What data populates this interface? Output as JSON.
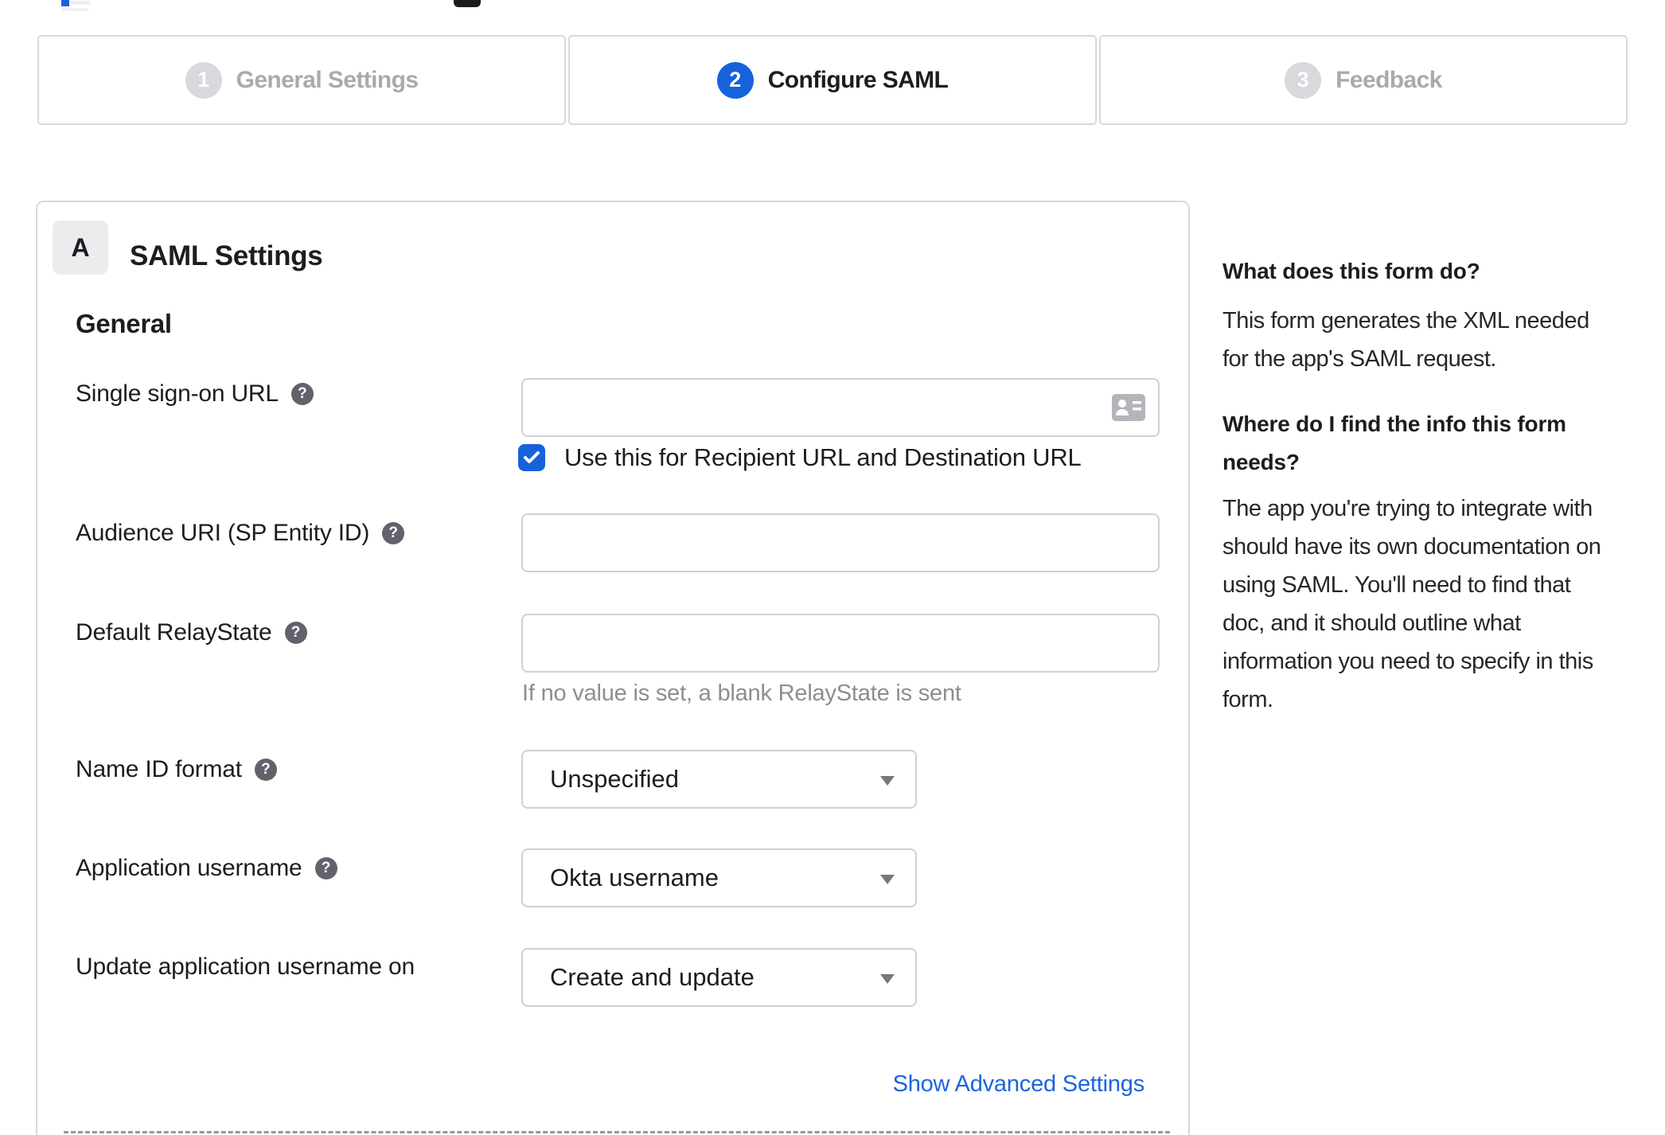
{
  "stepper": {
    "steps": [
      {
        "number": "1",
        "label": "General Settings",
        "state": "inactive"
      },
      {
        "number": "2",
        "label": "Configure SAML",
        "state": "active"
      },
      {
        "number": "3",
        "label": "Feedback",
        "state": "inactive"
      }
    ]
  },
  "section": {
    "badge": "A",
    "title": "SAML Settings",
    "subsection": "General"
  },
  "form": {
    "sso_url": {
      "label": "Single sign-on URL",
      "value": "",
      "checkbox_label": "Use this for Recipient URL and Destination URL"
    },
    "audience_uri": {
      "label": "Audience URI (SP Entity ID)",
      "value": ""
    },
    "default_relaystate": {
      "label": "Default RelayState",
      "value": "",
      "hint": "If no value is set, a blank RelayState is sent"
    },
    "name_id_format": {
      "label": "Name ID format",
      "value": "Unspecified"
    },
    "application_username": {
      "label": "Application username",
      "value": "Okta username"
    },
    "update_app_username": {
      "label": "Update application username on",
      "value": "Create and update"
    },
    "advanced_link": "Show Advanced Settings"
  },
  "sidebar": {
    "q1": "What does this form do?",
    "a1": "This form generates the XML needed\nfor the app's SAML request.",
    "q2": "Where do I find the info this form\nneeds?",
    "a2": "The app you're trying to integrate with\nshould have its own documentation on\nusing SAML. You'll need to find that\ndoc, and it should outline what\ninformation you need to specify in this\nform."
  },
  "colors": {
    "accent": "#1662dd"
  }
}
